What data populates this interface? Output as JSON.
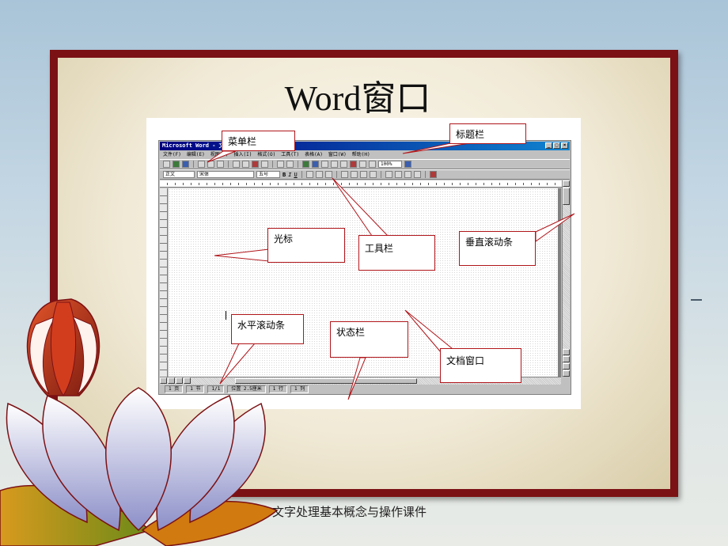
{
  "slide": {
    "title": "Word窗口",
    "footer": "文字处理基本概念与操作课件"
  },
  "word_window": {
    "title": "Microsoft Word - 文档1",
    "window_buttons": [
      "_",
      "□",
      "×"
    ],
    "menu_items": [
      "文件(F)",
      "编辑(E)",
      "视图(V)",
      "插入(I)",
      "格式(O)",
      "工具(T)",
      "表格(A)",
      "窗口(W)",
      "帮助(H)"
    ],
    "toolbar": {
      "zoom": "100%",
      "style": "正文",
      "font": "宋体",
      "size": "五号",
      "bold": "B",
      "italic": "I",
      "underline": "U"
    },
    "status_bar": [
      "1 页",
      "1 节",
      "1/1",
      "位置 2.5厘米",
      "1 行",
      "1 列"
    ]
  },
  "callouts": {
    "menu_bar": "菜单栏",
    "title_bar": "标题栏",
    "cursor": "光标",
    "toolbar": "工具栏",
    "vertical_scroll": "垂直滚动条",
    "horizontal_scroll": "水平滚动条",
    "status_bar": "状态栏",
    "doc_window": "文档窗口"
  },
  "colors": {
    "frame": "#7b1114",
    "callout_border": "#b0151a",
    "titlebar": "#000080"
  }
}
